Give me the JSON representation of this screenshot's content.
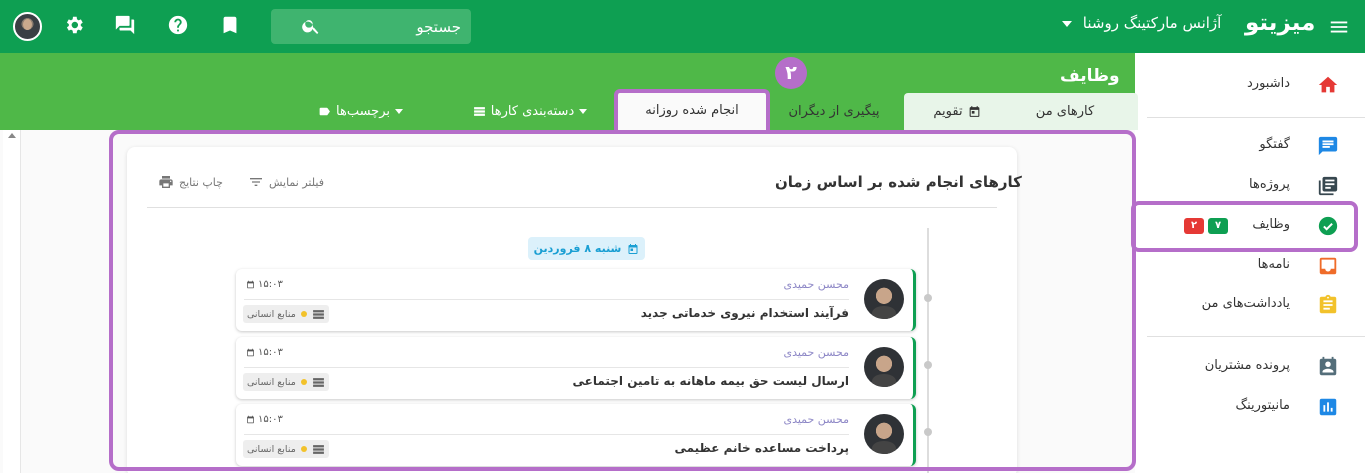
{
  "header": {
    "logo": "میزیتو",
    "agency": "آژانس مارکتینگ روشنا",
    "search_placeholder": "جستجو",
    "icons": [
      "hamburger-icon",
      "search-icon",
      "bookmark-icon",
      "help-icon",
      "chat-icon",
      "gear-icon",
      "avatar"
    ]
  },
  "sidebar": {
    "items": [
      {
        "label": "داشبورد",
        "icon": "home-icon",
        "color": "#e53935"
      },
      {
        "label": "گفتگو",
        "icon": "chat-icon",
        "color": "#1e88e5"
      },
      {
        "label": "پروژه‌ها",
        "icon": "projects-icon",
        "color": "#37474f"
      },
      {
        "label": "وظایف",
        "icon": "check-circle-icon",
        "color": "#0e9f52"
      },
      {
        "label": "نامه‌ها",
        "icon": "inbox-icon",
        "color": "#ef6c2a"
      },
      {
        "label": "یادداشت‌های من",
        "icon": "clipboard-icon",
        "color": "#f2c22b"
      },
      {
        "label": "پرونده مشتریان",
        "icon": "contact-icon",
        "color": "#546e7a"
      },
      {
        "label": "مانیتورینگ",
        "icon": "chart-icon",
        "color": "#1e88e5"
      }
    ],
    "badges": {
      "green": "۷",
      "red": "۲"
    }
  },
  "page": {
    "title": "وظایف",
    "step": "۲",
    "tabs": [
      {
        "label": "کارهای من"
      },
      {
        "label": "تقویم"
      },
      {
        "label": "پیگیری از دیگران"
      },
      {
        "label": "انجام شده روزانه"
      },
      {
        "label": "دسته‌بندی کارها"
      },
      {
        "label": "برچسب‌ها"
      }
    ]
  },
  "card": {
    "title": "کارهای انجام شده بر اساس زمان",
    "filter_label": "فیلتر نمایش",
    "print_label": "چاپ نتایج",
    "date": "شنبه ۸ فروردین",
    "tasks": [
      {
        "user": "محسن حمیدی",
        "time": "۱۵:۰۳",
        "title": "فرآیند استخدام نیروی خدماتی جدید",
        "tag": "منابع انسانی"
      },
      {
        "user": "محسن حمیدی",
        "time": "۱۵:۰۳",
        "title": "ارسال لیست حق بیمه ماهانه به تامین اجتماعی",
        "tag": "منابع انسانی"
      },
      {
        "user": "محسن حمیدی",
        "time": "۱۵:۰۳",
        "title": "پرداخت مساعده خانم عظیمی",
        "tag": "منابع انسانی"
      }
    ]
  },
  "colors": {
    "primary": "#0e9f52",
    "header_green": "#4fb848",
    "highlight": "#b56ec9"
  }
}
